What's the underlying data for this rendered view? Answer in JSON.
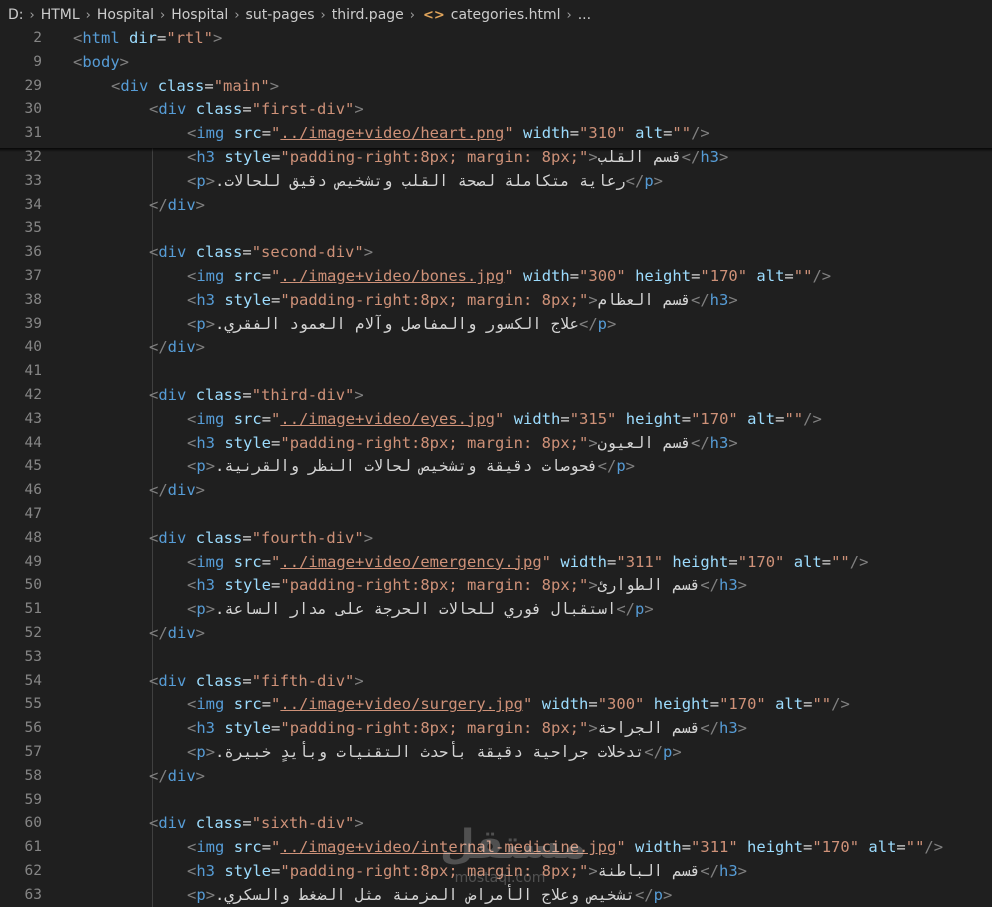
{
  "breadcrumb": {
    "items": [
      "D:",
      "HTML",
      "Hospital",
      "Hospital",
      "sut-pages",
      "third.page"
    ],
    "file_icon": "<>",
    "file": "categories.html",
    "more": "..."
  },
  "editor": {
    "lines": [
      {
        "n": "2",
        "indent": 0,
        "kind": "open",
        "tag": "html",
        "attrs": [
          [
            "dir",
            "\"rtl\""
          ]
        ]
      },
      {
        "n": "9",
        "indent": 0,
        "kind": "open",
        "tag": "body"
      },
      {
        "n": "29",
        "indent": 1,
        "kind": "open",
        "tag": "div",
        "attrs": [
          [
            "class",
            "\"main\""
          ]
        ]
      },
      {
        "n": "30",
        "indent": 2,
        "kind": "open",
        "tag": "div",
        "attrs": [
          [
            "class",
            "\"first-div\""
          ]
        ]
      },
      {
        "n": "31",
        "indent": 3,
        "kind": "img",
        "src": "../image+video/heart.png",
        "attrs": [
          [
            "width",
            "\"310\""
          ],
          [
            "alt",
            "\"\""
          ]
        ]
      },
      {
        "n": "32",
        "indent": 3,
        "kind": "h3",
        "text": "قسم القلب"
      },
      {
        "n": "33",
        "indent": 3,
        "kind": "p",
        "text": "رعاية متكاملة لصحة القلب وتشخيص دقيق للحالات."
      },
      {
        "n": "34",
        "indent": 2,
        "kind": "close",
        "tag": "div"
      },
      {
        "n": "35",
        "indent": 0,
        "kind": "blank"
      },
      {
        "n": "36",
        "indent": 2,
        "kind": "open",
        "tag": "div",
        "attrs": [
          [
            "class",
            "\"second-div\""
          ]
        ]
      },
      {
        "n": "37",
        "indent": 3,
        "kind": "img",
        "src": "../image+video/bones.jpg",
        "attrs": [
          [
            "width",
            "\"300\""
          ],
          [
            "height",
            "\"170\""
          ],
          [
            "alt",
            "\"\""
          ]
        ]
      },
      {
        "n": "38",
        "indent": 3,
        "kind": "h3",
        "text": "قسم العظام"
      },
      {
        "n": "39",
        "indent": 3,
        "kind": "p",
        "text": "علاج الكسور والمفاصل وآلام العمود الفقري."
      },
      {
        "n": "40",
        "indent": 2,
        "kind": "close",
        "tag": "div"
      },
      {
        "n": "41",
        "indent": 0,
        "kind": "blank"
      },
      {
        "n": "42",
        "indent": 2,
        "kind": "open",
        "tag": "div",
        "attrs": [
          [
            "class",
            "\"third-div\""
          ]
        ]
      },
      {
        "n": "43",
        "indent": 3,
        "kind": "img",
        "src": "../image+video/eyes.jpg",
        "attrs": [
          [
            "width",
            "\"315\""
          ],
          [
            "height",
            "\"170\""
          ],
          [
            "alt",
            "\"\""
          ]
        ]
      },
      {
        "n": "44",
        "indent": 3,
        "kind": "h3",
        "text": "قسم العيون"
      },
      {
        "n": "45",
        "indent": 3,
        "kind": "p",
        "text": "فحوصات دقيقة وتشخيص لحالات النظر والقرنية."
      },
      {
        "n": "46",
        "indent": 2,
        "kind": "close",
        "tag": "div"
      },
      {
        "n": "47",
        "indent": 0,
        "kind": "blank"
      },
      {
        "n": "48",
        "indent": 2,
        "kind": "open",
        "tag": "div",
        "attrs": [
          [
            "class",
            "\"fourth-div\""
          ]
        ]
      },
      {
        "n": "49",
        "indent": 3,
        "kind": "img",
        "src": "../image+video/emergency.jpg",
        "attrs": [
          [
            "width",
            "\"311\""
          ],
          [
            "height",
            "\"170\""
          ],
          [
            "alt",
            "\"\""
          ]
        ]
      },
      {
        "n": "50",
        "indent": 3,
        "kind": "h3",
        "text": "قسم الطوارئ"
      },
      {
        "n": "51",
        "indent": 3,
        "kind": "p",
        "text": "استقبال فوري للحالات الحرجة على مدار الساعة."
      },
      {
        "n": "52",
        "indent": 2,
        "kind": "close",
        "tag": "div"
      },
      {
        "n": "53",
        "indent": 0,
        "kind": "blank"
      },
      {
        "n": "54",
        "indent": 2,
        "kind": "open",
        "tag": "div",
        "attrs": [
          [
            "class",
            "\"fifth-div\""
          ]
        ]
      },
      {
        "n": "55",
        "indent": 3,
        "kind": "img",
        "src": "../image+video/surgery.jpg",
        "attrs": [
          [
            "width",
            "\"300\""
          ],
          [
            "height",
            "\"170\""
          ],
          [
            "alt",
            "\"\""
          ]
        ]
      },
      {
        "n": "56",
        "indent": 3,
        "kind": "h3",
        "text": "قسم الجراحة"
      },
      {
        "n": "57",
        "indent": 3,
        "kind": "p",
        "text": "تدخلات جراحية دقيقة بأحدث التقنيات وبأيدٍ خبيرة."
      },
      {
        "n": "58",
        "indent": 2,
        "kind": "close",
        "tag": "div"
      },
      {
        "n": "59",
        "indent": 0,
        "kind": "blank"
      },
      {
        "n": "60",
        "indent": 2,
        "kind": "open",
        "tag": "div",
        "attrs": [
          [
            "class",
            "\"sixth-div\""
          ]
        ]
      },
      {
        "n": "61",
        "indent": 3,
        "kind": "img",
        "src": "../image+video/internal-medicine.jpg",
        "attrs": [
          [
            "width",
            "\"311\""
          ],
          [
            "height",
            "\"170\""
          ],
          [
            "alt",
            "\"\""
          ]
        ]
      },
      {
        "n": "62",
        "indent": 3,
        "kind": "h3",
        "text": "قسم الباطنة"
      },
      {
        "n": "63",
        "indent": 3,
        "kind": "p",
        "text": "تشخيص وعلاج الأمراض المزمنة مثل الضغط والسكري."
      }
    ],
    "h3_style": "\"padding-right:8px; margin: 8px;\""
  },
  "watermark": {
    "arabic": "مستقل",
    "latin": "mostaql.com"
  },
  "colors": {
    "background": "#1f1f1f",
    "tag": "#569cd6",
    "attribute": "#9cdcfe",
    "string": "#ce9178",
    "bracket": "#808080",
    "line_number": "#858585"
  }
}
